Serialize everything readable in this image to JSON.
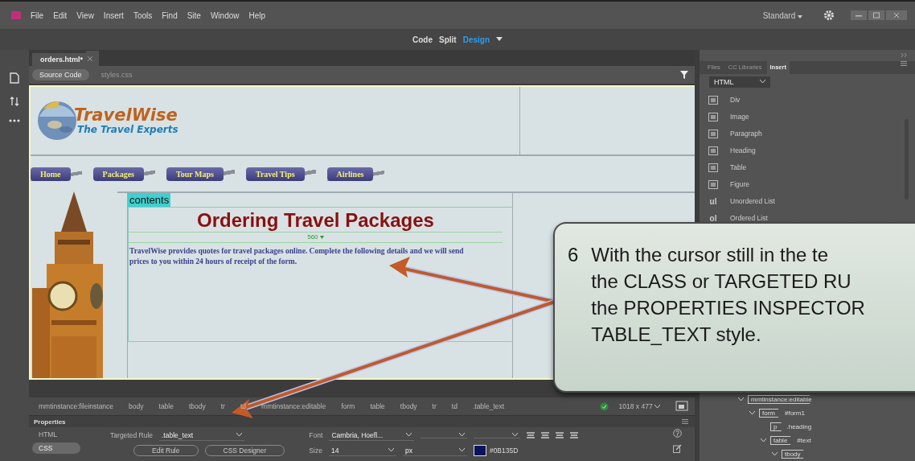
{
  "menu": [
    "File",
    "Edit",
    "View",
    "Insert",
    "Tools",
    "Find",
    "Site",
    "Window",
    "Help"
  ],
  "workspace": {
    "label": "Standard"
  },
  "view_modes": [
    {
      "label": "Code",
      "selected": false
    },
    {
      "label": "Split",
      "selected": false
    },
    {
      "label": "Design",
      "selected": true
    }
  ],
  "document_tab": {
    "label": "orders.html*"
  },
  "related_files": [
    {
      "label": "Source Code",
      "selected": true
    },
    {
      "label": "styles.css",
      "selected": false
    }
  ],
  "page": {
    "logo": {
      "title": "TravelWise",
      "tagline": "The Travel Experts"
    },
    "nav": [
      "Home",
      "Packages",
      "Tour Maps",
      "Travel Tips",
      "Airlines"
    ],
    "region_label": "contents",
    "heading": "Ordering Travel Packages",
    "width_marker": "560",
    "paragraph": "TravelWise provides quotes for travel packages online. Complete the following details and we will send prices to you within 24 hours of receipt of the form."
  },
  "tag_selector": {
    "tags": [
      "mmtinstance:fileinstance",
      "body",
      "table",
      "tbody",
      "tr",
      "td",
      "mmtinstance:editable",
      "form",
      "table",
      "tbody",
      "tr",
      "td",
      ".table_text"
    ],
    "size": "1018 x 477"
  },
  "properties": {
    "title": "Properties",
    "modes": [
      {
        "label": "HTML",
        "selected": false
      },
      {
        "label": "CSS",
        "selected": true
      }
    ],
    "targeted_rule_label": "Targeted Rule",
    "targeted_rule": ".table_text",
    "edit_rule": "Edit Rule",
    "css_designer": "CSS Designer",
    "font_label": "Font",
    "font": "Cambria, Hoefl...",
    "size_label": "Size",
    "size": "14",
    "unit": "px",
    "color": "#0B135D"
  },
  "panel": {
    "tabs": [
      {
        "label": "Files",
        "selected": false
      },
      {
        "label": "CC Libraries",
        "selected": false
      },
      {
        "label": "Insert",
        "selected": true
      }
    ],
    "category": "HTML",
    "items": [
      {
        "label": "Div",
        "kind": "icon"
      },
      {
        "label": "Image",
        "kind": "icon"
      },
      {
        "label": "Paragraph",
        "kind": "icon"
      },
      {
        "label": "Heading",
        "kind": "icon"
      },
      {
        "label": "Table",
        "kind": "icon"
      },
      {
        "label": "Figure",
        "kind": "icon"
      },
      {
        "label": "Unordered List",
        "kind": "glyph",
        "glyph": "ul"
      },
      {
        "label": "Ordered List",
        "kind": "glyph",
        "glyph": "ol"
      }
    ]
  },
  "dom_tree": [
    {
      "tag": "mmtinstance:editable",
      "expanded": true,
      "children": [
        {
          "tag": "form",
          "selector": "#form1",
          "expanded": true,
          "children": [
            {
              "tag": "p",
              "selector": ".heading"
            },
            {
              "tag": "table",
              "selector": "#text",
              "expanded": true,
              "children": [
                {
                  "tag": "tbody",
                  "expanded": true
                }
              ]
            }
          ]
        }
      ]
    }
  ],
  "callout": {
    "number": "6",
    "lines": [
      "With the cursor still in the te",
      "the CLASS or TARGETED RU",
      "the PROPERTIES INSPECTOR",
      "TABLE_TEXT style."
    ]
  }
}
